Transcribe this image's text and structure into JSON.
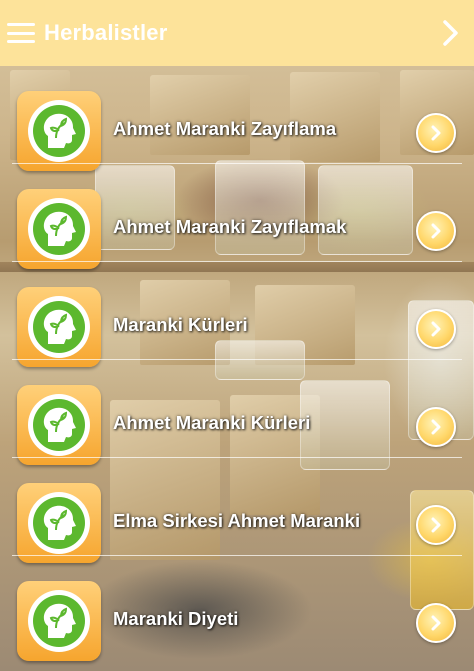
{
  "app_bar": {
    "title": "Herbalistler",
    "menu_icon": "hamburger-menu-icon",
    "next_icon": "chevron-right-icon",
    "background_color": "#fde39a"
  },
  "list": {
    "item_icon": "head-leaf-logo-icon",
    "action_icon": "chevron-right-circle-icon",
    "accent_color": "#f6a52e",
    "logo_green": "#5cb82e",
    "items": [
      {
        "label": "Ahmet Maranki Zayıflama"
      },
      {
        "label": "Ahmet Maranki Zayıflamak"
      },
      {
        "label": "Maranki Kürleri"
      },
      {
        "label": "Ahmet Maranki Kürleri"
      },
      {
        "label": "Elma Sirkesi Ahmet Maranki"
      },
      {
        "label": "Maranki Diyeti"
      }
    ]
  }
}
